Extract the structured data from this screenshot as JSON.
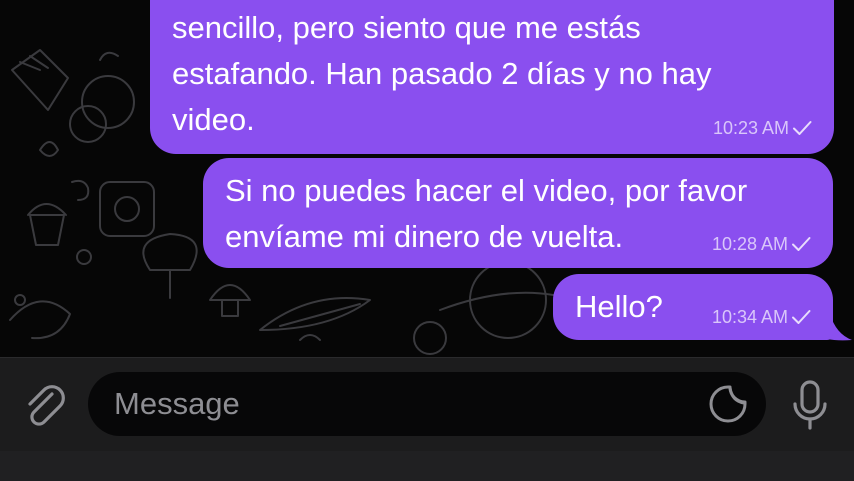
{
  "messages": [
    {
      "lines": [
        "sencillo, pero siento que me estás",
        "estafando. Han pasado 2 días y no hay",
        "video."
      ],
      "time": "10:23 AM",
      "status_icon": "checkmark-icon"
    },
    {
      "lines": [
        "Si no puedes hacer el video, por favor",
        "envíame mi dinero de vuelta."
      ],
      "time": "10:28 AM",
      "status_icon": "checkmark-icon"
    },
    {
      "lines": [
        "Hello?"
      ],
      "time": "10:34 AM",
      "status_icon": "checkmark-icon"
    }
  ],
  "composer": {
    "placeholder": "Message",
    "attach_icon": "paperclip-icon",
    "sticker_icon": "sticker-icon",
    "mic_icon": "microphone-icon"
  },
  "colors": {
    "bubble": "#8a4fef",
    "chat_background": "#060606",
    "composer_background": "#1c1c1d",
    "input_background": "#070708"
  }
}
